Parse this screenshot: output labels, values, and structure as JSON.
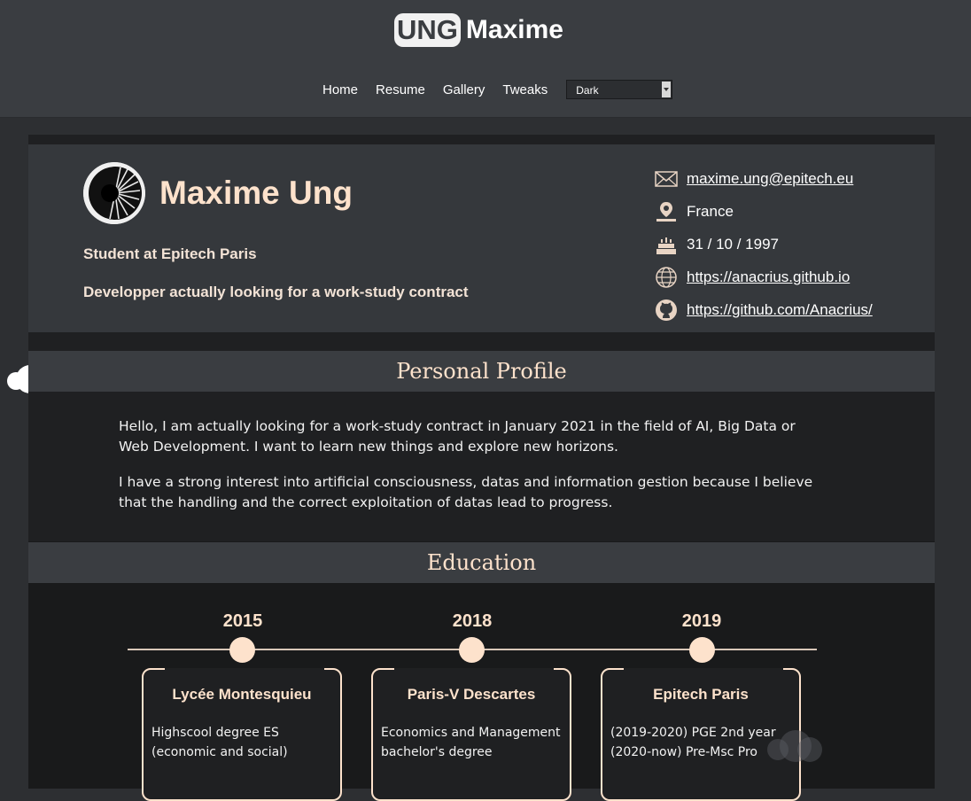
{
  "header": {
    "logo_badge": "UNG",
    "logo_name": "Maxime",
    "nav": [
      "Home",
      "Resume",
      "Gallery",
      "Tweaks"
    ],
    "theme_select": {
      "value": "Dark"
    }
  },
  "hero": {
    "name": "Maxime Ung",
    "subtitle": "Student at Epitech Paris",
    "tagline": "Developper actually looking for a work-study contract",
    "contacts": [
      {
        "icon": "mail-icon",
        "text": "maxime.ung@epitech.eu",
        "link": true
      },
      {
        "icon": "location-pin-icon",
        "text": "France",
        "link": false
      },
      {
        "icon": "birthday-cake-icon",
        "text": "31 / 10 / 1997",
        "link": false
      },
      {
        "icon": "globe-icon",
        "text": "https://anacrius.github.io",
        "link": true
      },
      {
        "icon": "github-icon",
        "text": "https://github.com/Anacrius/",
        "link": true
      }
    ]
  },
  "profile": {
    "heading": "Personal Profile",
    "paragraphs": [
      "Hello, I am actually looking for a work-study contract in January 2021 in the field of AI, Big Data or Web Development. I want to learn new things and explore new horizons.",
      "I have a strong interest into artificial consciousness, datas and information gestion because I believe that the handling and the correct exploitation of datas lead to progress."
    ]
  },
  "education": {
    "heading": "Education",
    "items": [
      {
        "year": "2015",
        "school": "Lycée Montesquieu",
        "desc": "Highscool degree ES (economic and social)"
      },
      {
        "year": "2018",
        "school": "Paris-V Descartes",
        "desc": "Economics and Management bachelor's degree"
      },
      {
        "year": "2019",
        "school": "Epitech Paris",
        "desc": "(2019-2020) PGE 2nd year (2020-now) Pre-Msc Pro"
      }
    ]
  },
  "colors": {
    "accent": "#fde2cc",
    "header_bg": "#3a3d41",
    "page_bg": "#2d2f32",
    "content_bg": "#1f2022"
  }
}
